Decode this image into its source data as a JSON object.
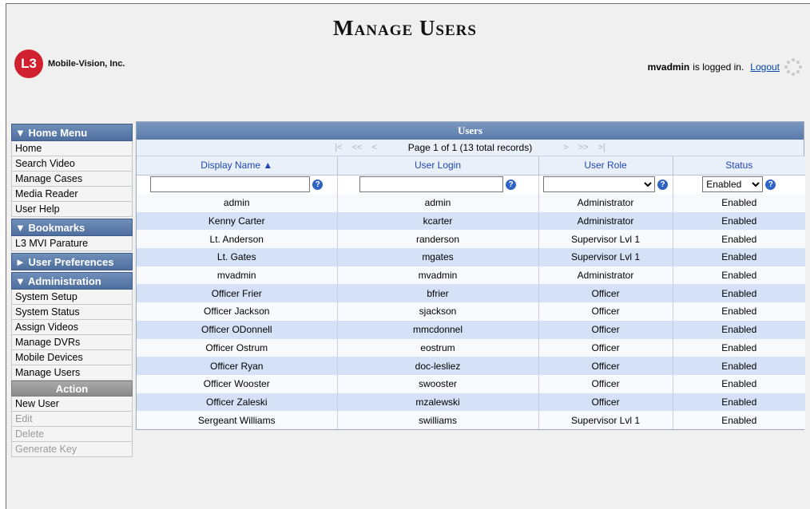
{
  "page": {
    "title": "Manage Users",
    "logo_mark": "L3",
    "company": "Mobile-Vision, Inc.",
    "logged_user": "mvadmin",
    "logged_suffix": "is logged in.",
    "logout": "Logout"
  },
  "sidebar": {
    "home_menu": {
      "title": "▼ Home Menu",
      "items": [
        "Home",
        "Search Video",
        "Manage Cases",
        "Media Reader",
        "User Help"
      ]
    },
    "bookmarks": {
      "title": "▼ Bookmarks",
      "items": [
        "L3 MVI Parature"
      ]
    },
    "user_prefs": {
      "title": "► User Preferences"
    },
    "administration": {
      "title": "▼ Administration",
      "items": [
        "System Setup",
        "System Status",
        "Assign Videos",
        "Manage DVRs",
        "Mobile Devices",
        "Manage Users"
      ]
    },
    "action": {
      "title": "Action",
      "items": [
        {
          "label": "New User",
          "enabled": true
        },
        {
          "label": "Edit",
          "enabled": false
        },
        {
          "label": "Delete",
          "enabled": false
        },
        {
          "label": "Generate Key",
          "enabled": false
        }
      ]
    }
  },
  "users": {
    "title": "Users",
    "pager_text": "Page 1 of 1 (13 total records)",
    "columns": [
      "Display Name ▲",
      "User Login",
      "User Role",
      "Status"
    ],
    "filters": {
      "display_name": "",
      "user_login": "",
      "user_role": "",
      "status": "Enabled"
    },
    "rows": [
      [
        "admin",
        "admin",
        "Administrator",
        "Enabled"
      ],
      [
        "Kenny Carter",
        "kcarter",
        "Administrator",
        "Enabled"
      ],
      [
        "Lt. Anderson",
        "randerson",
        "Supervisor Lvl 1",
        "Enabled"
      ],
      [
        "Lt. Gates",
        "mgates",
        "Supervisor Lvl 1",
        "Enabled"
      ],
      [
        "mvadmin",
        "mvadmin",
        "Administrator",
        "Enabled"
      ],
      [
        "Officer Frier",
        "bfrier",
        "Officer",
        "Enabled"
      ],
      [
        "Officer Jackson",
        "sjackson",
        "Officer",
        "Enabled"
      ],
      [
        "Officer ODonnell",
        "mmcdonnel",
        "Officer",
        "Enabled"
      ],
      [
        "Officer Ostrum",
        "eostrum",
        "Officer",
        "Enabled"
      ],
      [
        "Officer Ryan",
        "doc-lesliez",
        "Officer",
        "Enabled"
      ],
      [
        "Officer Wooster",
        "swooster",
        "Officer",
        "Enabled"
      ],
      [
        "Officer Zaleski",
        "mzalewski",
        "Officer",
        "Enabled"
      ],
      [
        "Sergeant Williams",
        "swilliams",
        "Supervisor Lvl 1",
        "Enabled"
      ]
    ]
  },
  "colors": {
    "header_blue": "#5a7aaa",
    "link_blue": "#1e46b4",
    "row_alt": "#d5e1f6",
    "logo_red": "#d01f2d"
  }
}
